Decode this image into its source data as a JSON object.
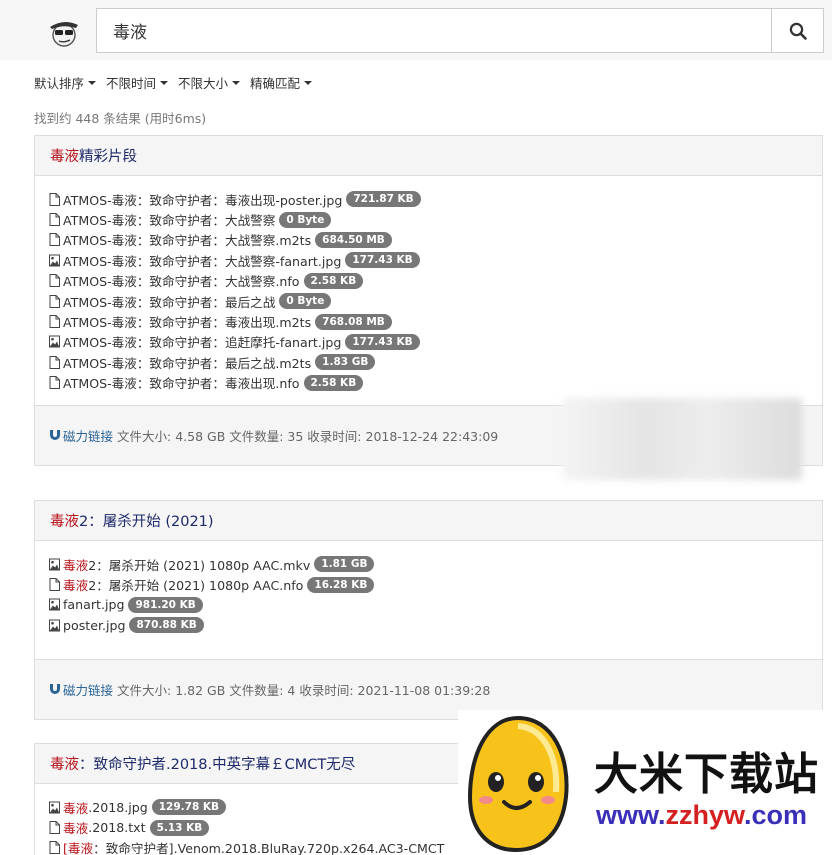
{
  "search": {
    "query": "毒液",
    "button_icon": "search-icon"
  },
  "filters": [
    "默认排序",
    "不限时间",
    "不限大小",
    "精确匹配"
  ],
  "result_count": "找到约 448 条结果 (用时6ms)",
  "cards": [
    {
      "title_hl": "毒液",
      "title_rest": "精彩片段",
      "files": [
        {
          "type": "file",
          "hl": "",
          "name": "ATMOS-毒液：致命守护者：毒液出现-poster.jpg",
          "size": "721.87 KB"
        },
        {
          "type": "file",
          "hl": "",
          "name": "ATMOS-毒液：致命守护者：大战警察",
          "size": "0 Byte"
        },
        {
          "type": "file",
          "hl": "",
          "name": "ATMOS-毒液：致命守护者：大战警察.m2ts",
          "size": "684.50 MB"
        },
        {
          "type": "image",
          "hl": "",
          "name": "ATMOS-毒液：致命守护者：大战警察-fanart.jpg",
          "size": "177.43 KB"
        },
        {
          "type": "file",
          "hl": "",
          "name": "ATMOS-毒液：致命守护者：大战警察.nfo",
          "size": "2.58 KB"
        },
        {
          "type": "file",
          "hl": "",
          "name": "ATMOS-毒液：致命守护者：最后之战",
          "size": "0 Byte"
        },
        {
          "type": "file",
          "hl": "",
          "name": "ATMOS-毒液：致命守护者：毒液出现.m2ts",
          "size": "768.08 MB"
        },
        {
          "type": "image",
          "hl": "",
          "name": "ATMOS-毒液：致命守护者：追赶摩托-fanart.jpg",
          "size": "177.43 KB"
        },
        {
          "type": "file",
          "hl": "",
          "name": "ATMOS-毒液：致命守护者：最后之战.m2ts",
          "size": "1.83 GB"
        },
        {
          "type": "file",
          "hl": "",
          "name": "ATMOS-毒液：致命守护者：毒液出现.nfo",
          "size": "2.58 KB"
        }
      ],
      "magnet_label": "磁力链接",
      "meta": "文件大小: 4.58 GB 文件数量: 35 收录时间: 2018-12-24 22:43:09"
    },
    {
      "title_hl": "毒液",
      "title_rest": "2：屠杀开始 (2021)",
      "files": [
        {
          "type": "image",
          "hl": "毒液",
          "name": "2：屠杀开始 (2021) 1080p AAC.mkv",
          "size": "1.81 GB"
        },
        {
          "type": "file",
          "hl": "毒液",
          "name": "2：屠杀开始 (2021) 1080p AAC.nfo",
          "size": "16.28 KB"
        },
        {
          "type": "image",
          "hl": "",
          "name": "fanart.jpg",
          "size": "981.20 KB"
        },
        {
          "type": "image",
          "hl": "",
          "name": "poster.jpg",
          "size": "870.88 KB"
        }
      ],
      "magnet_label": "磁力链接",
      "meta": "文件大小: 1.82 GB 文件数量: 4 收录时间: 2021-11-08 01:39:28"
    },
    {
      "title_hl": "毒液",
      "title_rest": "：致命守护者.2018.中英字幕￡CMCT无尽",
      "files": [
        {
          "type": "image",
          "hl": "毒液",
          "name": ".2018.jpg",
          "size": "129.78 KB"
        },
        {
          "type": "file",
          "hl": "毒液",
          "name": ".2018.txt",
          "size": "5.13 KB"
        },
        {
          "type": "file",
          "hl": "[毒液",
          "name": "：致命守护者].Venom.2018.BluRay.720p.x264.AC3-CMCT",
          "size": ""
        }
      ]
    }
  ],
  "watermark": {
    "cn": "大米下载站",
    "url_a": "www.",
    "url_b": "zzhyw",
    "url_c": ".com"
  }
}
